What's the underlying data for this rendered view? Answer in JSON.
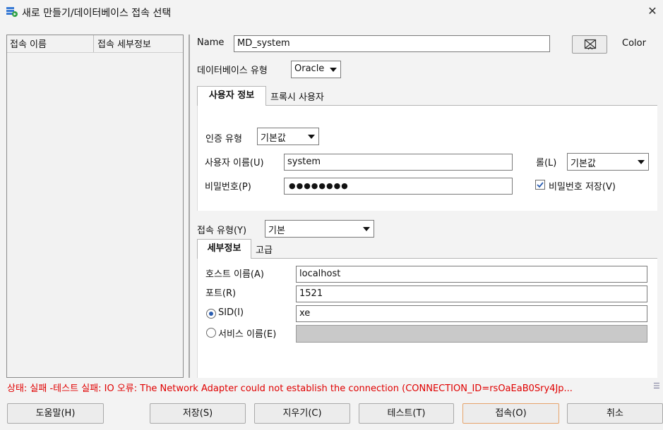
{
  "window": {
    "title": "새로 만들기/데이터베이스 접속 선택",
    "close_glyph": "✕"
  },
  "connections_list": {
    "col_name": "접속 이름",
    "col_details": "접속 세부정보"
  },
  "form": {
    "name_label": "Name",
    "name_value": "MD_system",
    "color_label": "Color",
    "dbtype_label": "데이터베이스 유형",
    "dbtype_value": "Oracle",
    "user_tabs": [
      "사용자 정보",
      "프록시 사용자"
    ],
    "auth_label": "인증 유형",
    "auth_value": "기본값",
    "username_label": "사용자 이름(U)",
    "username_value": "system",
    "role_label": "롤(L)",
    "role_value": "기본값",
    "password_label": "비밀번호(P)",
    "password_mask": "●●●●●●●●",
    "save_password_label": "비밀번호 저장(V)",
    "save_password_checked": true,
    "conntype_label": "접속 유형(Y)",
    "conntype_value": "기본",
    "conn_tabs": [
      "세부정보",
      "고급"
    ],
    "host_label": "호스트 이름(A)",
    "host_value": "localhost",
    "port_label": "포트(R)",
    "port_value": "1521",
    "sid_label": "SID(I)",
    "sid_value": "xe",
    "sid_selected": true,
    "service_label": "서비스 이름(E)",
    "service_value": ""
  },
  "status": {
    "text": "상태: 실패 -테스트 실패: IO 오류: The Network Adapter could not establish the connection (CONNECTION_ID=rsOaEaB0Sry4Jp...",
    "color": "#e00000"
  },
  "buttons": {
    "help": "도움말(H)",
    "save": "저장(S)",
    "clear": "지우기(C)",
    "test": "테스트(T)",
    "connect": "접속(O)",
    "cancel": "취소"
  }
}
